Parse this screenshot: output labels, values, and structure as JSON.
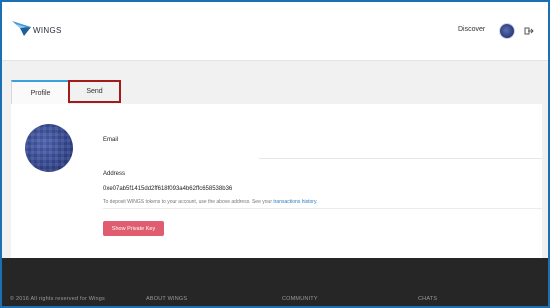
{
  "brand": {
    "name": "WINGS"
  },
  "header": {
    "discover_label": "Discover"
  },
  "tabs": [
    {
      "label": "Profile",
      "active": true
    },
    {
      "label": "Send",
      "active": false
    }
  ],
  "profile": {
    "email_label": "Email",
    "email_value": "",
    "address_label": "Address",
    "address_value": "0xe07ab5f1415dd2ff618f093a4b62ffc658538b36",
    "hint_text": "To deposit WINGS tokens to your account, use the above address. See your ",
    "hint_link": "transactions history",
    "hint_tail": ".",
    "show_key_button": "Show Private Key"
  },
  "footer": {
    "copyright": "© 2016 All rights reserved for Wings",
    "col1": "ABOUT WINGS",
    "col2": "COMMUNITY",
    "col3": "CHATS"
  },
  "colors": {
    "accent_tab": "#3aa0e0",
    "button": "#e05d6f",
    "highlight_box": "#a31a1a",
    "footer_bg": "#262626"
  },
  "icons": [
    "wings-logo-icon",
    "logout-icon"
  ]
}
